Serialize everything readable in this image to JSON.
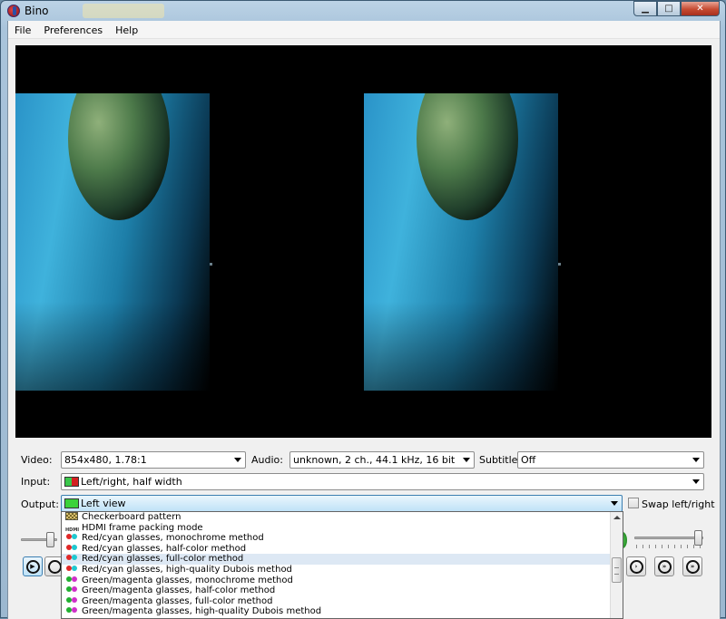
{
  "window": {
    "title": "Bino"
  },
  "menu": [
    "File",
    "Preferences",
    "Help"
  ],
  "video": {
    "label": "Video:",
    "value": "854x480, 1.78:1"
  },
  "audio": {
    "label": "Audio:",
    "value": "unknown, 2 ch., 44.1 kHz, 16 bit"
  },
  "subtitle": {
    "label": "Subtitle:",
    "value": "Off"
  },
  "input": {
    "label": "Input:",
    "value": "Left/right, half width"
  },
  "output": {
    "label": "Output:",
    "value": "Left view",
    "options": [
      {
        "label": "Checkerboard pattern",
        "icon": "checkerboard-icon"
      },
      {
        "label": "HDMI frame packing mode",
        "icon": "hdmi-icon",
        "icon_text": "HDMI"
      },
      {
        "label": "Red/cyan glasses, monochrome method",
        "icon": "red-cyan-glasses-icon"
      },
      {
        "label": "Red/cyan glasses, half-color method",
        "icon": "red-cyan-glasses-icon"
      },
      {
        "label": "Red/cyan glasses, full-color method",
        "icon": "red-cyan-glasses-icon",
        "highlighted": true
      },
      {
        "label": "Red/cyan glasses, high-quality Dubois method",
        "icon": "red-cyan-glasses-icon"
      },
      {
        "label": "Green/magenta glasses, monochrome method",
        "icon": "green-magenta-glasses-icon"
      },
      {
        "label": "Green/magenta glasses, half-color method",
        "icon": "green-magenta-glasses-icon"
      },
      {
        "label": "Green/magenta glasses, full-color method",
        "icon": "green-magenta-glasses-icon"
      },
      {
        "label": "Green/magenta glasses, high-quality Dubois method",
        "icon": "green-magenta-glasses-icon"
      }
    ]
  },
  "swap": {
    "label": "Swap left/right",
    "checked": false
  },
  "seek": {
    "position": 0.03
  },
  "volume": {
    "level": 1.0
  },
  "colors": {
    "accent": "#3c7fb1",
    "highlight": "#dde8f4"
  }
}
